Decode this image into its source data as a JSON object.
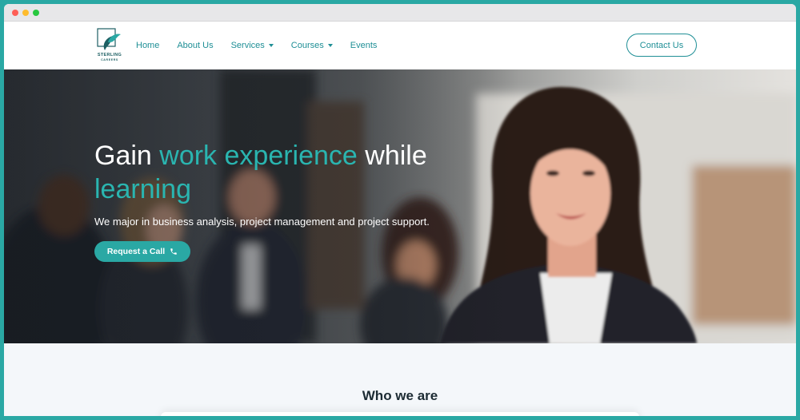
{
  "brand": {
    "name": "STERLING",
    "tagline": "CAREERS"
  },
  "nav": {
    "items": [
      {
        "label": "Home",
        "dropdown": false
      },
      {
        "label": "About Us",
        "dropdown": false
      },
      {
        "label": "Services",
        "dropdown": true
      },
      {
        "label": "Courses",
        "dropdown": true
      },
      {
        "label": "Events",
        "dropdown": false
      }
    ],
    "contact_label": "Contact Us"
  },
  "hero": {
    "title_part1": "Gain ",
    "title_accent1": "work experience",
    "title_part2": " while",
    "title_accent2": "learning",
    "subtitle": "We major in business analysis, project management and project support.",
    "cta_label": "Request a Call",
    "cta_icon": "phone-icon"
  },
  "about": {
    "title": "Who we are"
  },
  "colors": {
    "accent": "#2aa8a4",
    "nav_text": "#1f8f96",
    "heading": "#1c2b33"
  }
}
